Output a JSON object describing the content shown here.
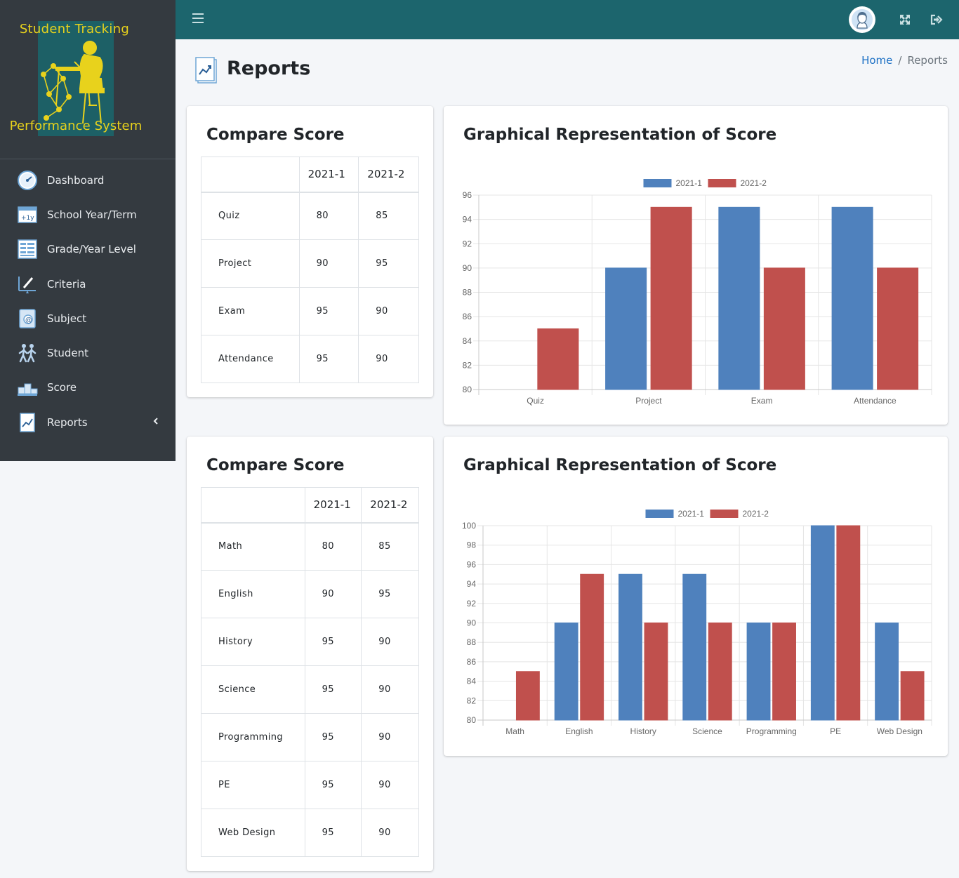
{
  "brand": {
    "line1": "Student Tracking",
    "line2": "Performance System"
  },
  "sidebar": {
    "items": [
      {
        "label": "Dashboard",
        "icon": "dashboard-gauge-icon"
      },
      {
        "label": "School Year/Term",
        "icon": "calendar-plus-icon"
      },
      {
        "label": "Grade/Year Level",
        "icon": "grid-form-icon"
      },
      {
        "label": "Criteria",
        "icon": "criteria-pencil-icon"
      },
      {
        "label": "Subject",
        "icon": "subject-book-icon"
      },
      {
        "label": "Student",
        "icon": "students-walking-icon"
      },
      {
        "label": "Score",
        "icon": "podium-icon"
      },
      {
        "label": "Reports",
        "icon": "report-chart-icon"
      }
    ]
  },
  "topbar": {
    "menu_icon": "hamburger-icon",
    "avatar_icon": "user-avatar-icon",
    "fullscreen_icon": "expand-icon",
    "logout_icon": "sign-out-icon"
  },
  "page": {
    "title": "Reports",
    "breadcrumb_home": "Home",
    "breadcrumb_sep": "/",
    "breadcrumb_current": "Reports"
  },
  "colors": {
    "series1": "#4f81bd",
    "series2": "#c0504d",
    "topbar": "#1c656d",
    "sidebar": "#343a40"
  },
  "panels": [
    {
      "table_title": "Compare Score",
      "chart_title": "Graphical Representation of Score",
      "columns": [
        "",
        "2021-1",
        "2021-2"
      ],
      "rows": [
        {
          "label": "Quiz",
          "v1": "80",
          "v2": "85"
        },
        {
          "label": "Project",
          "v1": "90",
          "v2": "95"
        },
        {
          "label": "Exam",
          "v1": "95",
          "v2": "90"
        },
        {
          "label": "Attendance",
          "v1": "95",
          "v2": "90"
        }
      ]
    },
    {
      "table_title": "Compare Score",
      "chart_title": "Graphical Representation of Score",
      "columns": [
        "",
        "2021-1",
        "2021-2"
      ],
      "rows": [
        {
          "label": "Math",
          "v1": "80",
          "v2": "85"
        },
        {
          "label": "English",
          "v1": "90",
          "v2": "95"
        },
        {
          "label": "History",
          "v1": "95",
          "v2": "90"
        },
        {
          "label": "Science",
          "v1": "95",
          "v2": "90"
        },
        {
          "label": "Programming",
          "v1": "95",
          "v2": "90"
        },
        {
          "label": "PE",
          "v1": "95",
          "v2": "90"
        },
        {
          "label": "Web Design",
          "v1": "95",
          "v2": "90"
        }
      ]
    }
  ],
  "chart_data": [
    {
      "type": "bar",
      "title": "Graphical Representation of Score",
      "categories": [
        "Quiz",
        "Project",
        "Exam",
        "Attendance"
      ],
      "series": [
        {
          "name": "2021-1",
          "values": [
            80,
            90,
            95,
            95
          ]
        },
        {
          "name": "2021-2",
          "values": [
            85,
            95,
            90,
            90
          ]
        }
      ],
      "ylim": [
        80,
        96
      ],
      "yticks": [
        80,
        82,
        84,
        86,
        88,
        90,
        92,
        94,
        96
      ],
      "grid": true,
      "legend": "top-center"
    },
    {
      "type": "bar",
      "title": "Graphical Representation of Score",
      "categories": [
        "Math",
        "English",
        "History",
        "Science",
        "Programming",
        "PE",
        "Web Design"
      ],
      "series": [
        {
          "name": "2021-1",
          "values": [
            80,
            90,
            95,
            95,
            90,
            100,
            90
          ]
        },
        {
          "name": "2021-2",
          "values": [
            85,
            95,
            90,
            90,
            90,
            100,
            85
          ]
        }
      ],
      "ylim": [
        80,
        100
      ],
      "yticks": [
        80,
        82,
        84,
        86,
        88,
        90,
        92,
        94,
        96,
        98,
        100
      ],
      "grid": true,
      "legend": "top-center"
    }
  ]
}
